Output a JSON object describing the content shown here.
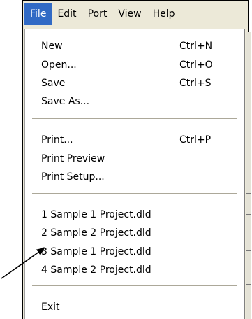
{
  "menubar": {
    "file": "File",
    "edit": "Edit",
    "port": "Port",
    "view": "View",
    "help": "Help"
  },
  "file_menu": {
    "new": {
      "label": "New",
      "shortcut": "Ctrl+N"
    },
    "open": {
      "label": "Open...",
      "shortcut": "Ctrl+O"
    },
    "save": {
      "label": "Save",
      "shortcut": "Ctrl+S"
    },
    "save_as": {
      "label": "Save As..."
    },
    "print": {
      "label": "Print...",
      "shortcut": "Ctrl+P"
    },
    "print_preview": {
      "label": "Print Preview"
    },
    "print_setup": {
      "label": "Print Setup..."
    },
    "recent": [
      "1 Sample 1 Project.dld",
      "2 Sample 2 Project.dld",
      "3 Sample 1 Project.dld",
      "4 Sample 2 Project.dld"
    ],
    "exit": {
      "label": "Exit"
    }
  },
  "colors": {
    "active_menu": "#316ac5",
    "menu_bg": "#ffffff",
    "bar_bg": "#ece9d8"
  }
}
